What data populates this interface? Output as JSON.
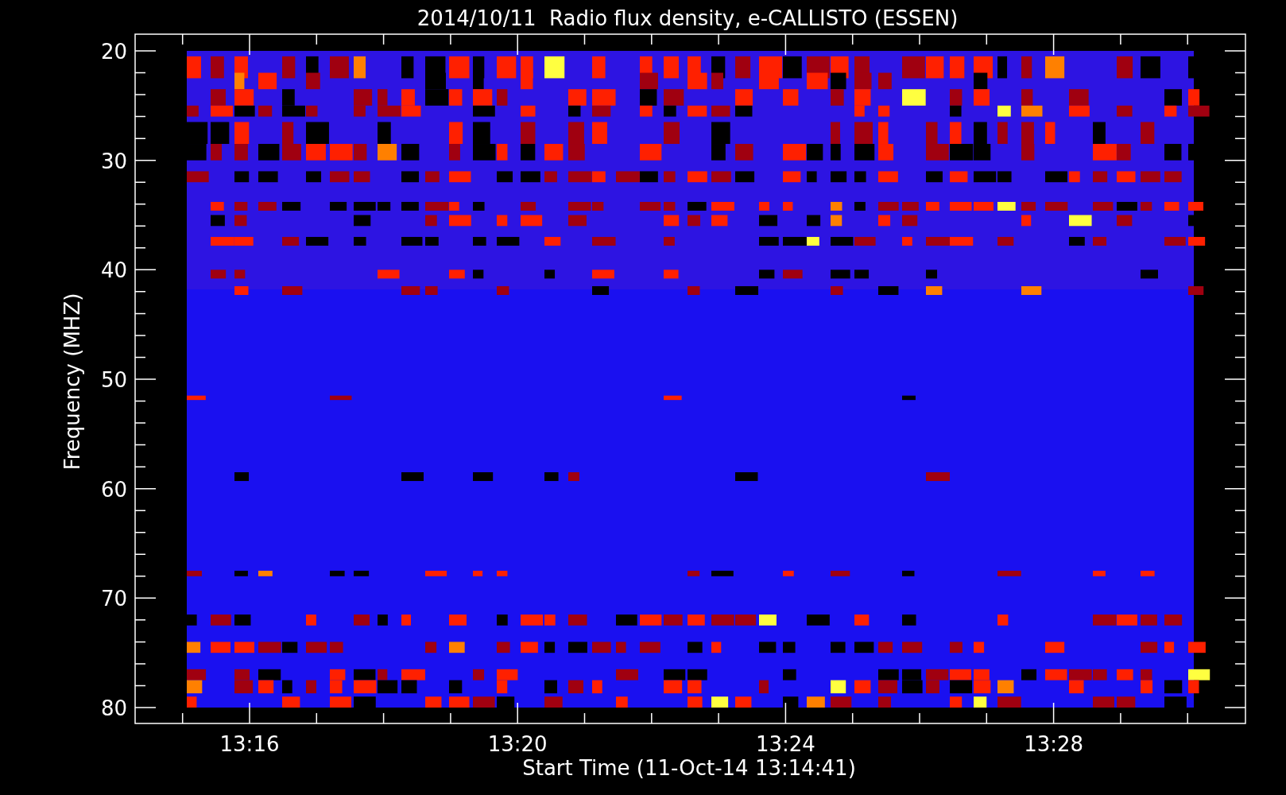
{
  "title": "2014/10/11  Radio flux density, e-CALLISTO (ESSEN)",
  "y_axis": {
    "label": "Frequency (MHZ)",
    "ticks": [
      "20",
      "30",
      "40",
      "50",
      "60",
      "70",
      "80"
    ]
  },
  "x_axis": {
    "label": "Start Time (11-Oct-14 13:14:41)",
    "ticks": [
      "13:16",
      "13:20",
      "13:24",
      "13:28"
    ]
  }
}
